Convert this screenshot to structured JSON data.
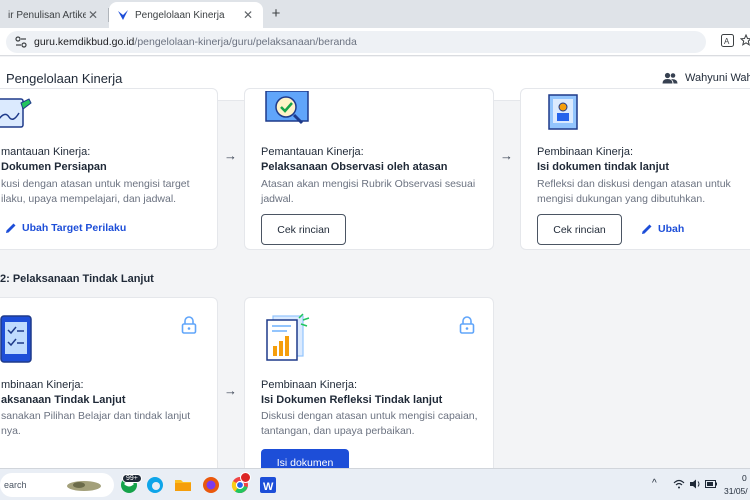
{
  "browser": {
    "tabs": [
      {
        "title": "ir Penulisan Artikel",
        "active": false
      },
      {
        "title": "Pengelolaan Kinerja",
        "active": true
      }
    ],
    "url_host": "guru.kemdikbud.go.id",
    "url_path": "/pengelolaan-kinerja/guru/pelaksanaan/beranda"
  },
  "app": {
    "title": "Pengelolaan Kinerja",
    "user_name": "Wahyuni Wah"
  },
  "stage1_cards": [
    {
      "title_line1": "mantauan Kinerja:",
      "title_line2": "Dokumen Persiapan",
      "desc": [
        "kusi dengan atasan untuk mengisi target",
        "ilaku, upaya mempelajari, dan jadwal."
      ],
      "link_label": "Ubah Target Perilaku"
    },
    {
      "title_line1": "Pemantauan Kinerja:",
      "title_line2": "Pelaksanaan Observasi oleh atasan",
      "desc": [
        "Atasan akan mengisi Rubrik Observasi sesuai",
        "jadwal."
      ],
      "button_label": "Cek rincian"
    },
    {
      "title_line1": "Pembinaan Kinerja:",
      "title_line2": "Isi dokumen tindak lanjut",
      "desc": [
        "Refleksi dan diskusi dengan atasan untuk",
        "mengisi dukungan yang dibutuhkan."
      ],
      "button_label": "Cek rincian",
      "link_label": "Ubah"
    }
  ],
  "stage2": {
    "section_title": "2: Pelaksanaan Tindak Lanjut",
    "cards": [
      {
        "title_line1": "mbinaan Kinerja:",
        "title_line2": "aksanaan Tindak Lanjut",
        "desc": [
          "sanakan Pilihan Belajar dan tindak lanjut",
          "nya."
        ]
      },
      {
        "title_line1": "Pembinaan Kinerja:",
        "title_line2": "Isi Dokumen Refleksi Tindak lanjut",
        "desc": [
          "Diskusi dengan atasan untuk mengisi capaian,",
          "tantangan, dan upaya perbaikan."
        ],
        "button_label": "Isi dokumen"
      }
    ]
  },
  "taskbar": {
    "search_label": "earch",
    "badge": "99+",
    "clock": "0",
    "date": "31/05/"
  },
  "colors": {
    "primary": "#1d4ed8",
    "card_border": "#e5e7eb",
    "background": "#f3f4f6"
  }
}
